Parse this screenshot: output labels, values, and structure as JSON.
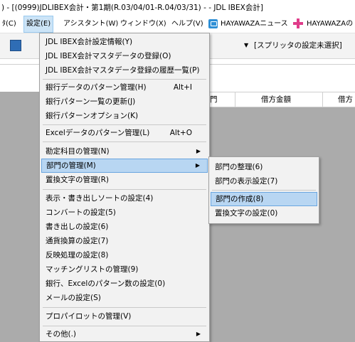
{
  "window": {
    "title": ") - [(0999)JDLIBEX会計・第1期(R.03/04/01-R.04/03/31) - - JDL IBEX会計]"
  },
  "menubar": {
    "items": [
      {
        "label": "ﾀ(C)"
      },
      {
        "label": "設定(E)"
      },
      {
        "label": "アシスタント(W)"
      },
      {
        "label": "ウィンドウ(X)"
      },
      {
        "label": "ヘルプ(V)"
      },
      {
        "label": "HAYAWAZAニュース"
      },
      {
        "label": "HAYAWAZAの"
      }
    ]
  },
  "toolbar": {
    "splitter_label": "[スプリッタの設定未選択]",
    "splitter_arrow": "▼"
  },
  "grid": {
    "columns": [
      "門",
      "借方金額",
      "借方"
    ]
  },
  "settings_menu": {
    "items": [
      {
        "label": "JDL IBEX会計設定情報(Y)"
      },
      {
        "label": "JDL IBEX会計マスタデータの登録(O)"
      },
      {
        "label": "JDL IBEX会計マスタデータ登録の履歴一覧(P)"
      },
      {
        "label": "銀行データのパターン管理(H)",
        "shortcut": "Alt+I"
      },
      {
        "label": "銀行パターン一覧の更新(J)"
      },
      {
        "label": "銀行パターンオプション(K)"
      },
      {
        "label": "Excelデータのパターン管理(L)",
        "shortcut": "Alt+O"
      },
      {
        "label": "勘定科目の管理(N)",
        "arrow": "▶"
      },
      {
        "label": "部門の管理(M)",
        "arrow": "▶"
      },
      {
        "label": "置換文字の管理(R)"
      },
      {
        "label": "表示・書き出しソートの設定(4)"
      },
      {
        "label": "コンバートの設定(5)"
      },
      {
        "label": "書き出しの設定(6)"
      },
      {
        "label": "通貨換算の設定(7)"
      },
      {
        "label": "反映処理の設定(8)"
      },
      {
        "label": "マッチングリストの管理(9)"
      },
      {
        "label": "銀行、Excelのパターン数の設定(0)"
      },
      {
        "label": "メールの設定(S)"
      },
      {
        "label": "プロパイロットの管理(V)"
      },
      {
        "label": "その他(.)",
        "arrow": "▶"
      }
    ]
  },
  "department_submenu": {
    "items": [
      {
        "label": "部門の整理(6)"
      },
      {
        "label": "部門の表示設定(7)"
      },
      {
        "label": "部門の作成(8)"
      },
      {
        "label": "置換文字の設定(0)"
      }
    ]
  }
}
